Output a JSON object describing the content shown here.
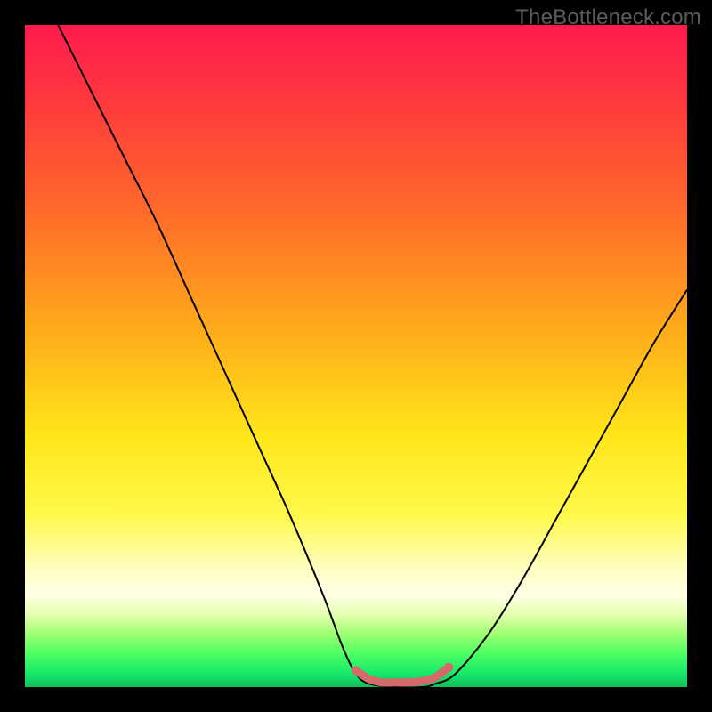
{
  "watermark": "TheBottleneck.com",
  "chart_data": {
    "type": "line",
    "title": "",
    "xlabel": "",
    "ylabel": "",
    "xlim": [
      0,
      100
    ],
    "ylim": [
      0,
      100
    ],
    "grid": false,
    "legend": false,
    "background": {
      "type": "vertical-gradient",
      "stops": [
        {
          "pct": 0,
          "color": "#ff1a4d"
        },
        {
          "pct": 12,
          "color": "#ff3a3d"
        },
        {
          "pct": 28,
          "color": "#ff6a2a"
        },
        {
          "pct": 48,
          "color": "#ffb21a"
        },
        {
          "pct": 62,
          "color": "#ffe61a"
        },
        {
          "pct": 74,
          "color": "#fff94a"
        },
        {
          "pct": 82,
          "color": "#fffec0"
        },
        {
          "pct": 86,
          "color": "#ffffe6"
        },
        {
          "pct": 89,
          "color": "#e6ffb0"
        },
        {
          "pct": 92,
          "color": "#9dff70"
        },
        {
          "pct": 95,
          "color": "#4cff63"
        },
        {
          "pct": 98,
          "color": "#16e86a"
        },
        {
          "pct": 100,
          "color": "#0fbf5b"
        }
      ]
    },
    "series": [
      {
        "name": "bottleneck-curve",
        "color": "#000000",
        "stroke_width": 2,
        "x": [
          5,
          10,
          15,
          20,
          25,
          30,
          35,
          40,
          45,
          48,
          50,
          52,
          56,
          60,
          62,
          65,
          70,
          75,
          80,
          85,
          90,
          95,
          100
        ],
        "y": [
          100,
          90,
          80,
          70,
          59,
          48,
          37,
          26,
          14,
          6,
          2,
          0.5,
          0,
          0,
          0.5,
          2,
          8,
          16,
          25,
          34,
          43,
          52,
          60
        ]
      },
      {
        "name": "optimal-range-highlight",
        "color": "#d46a6a",
        "stroke_width": 9,
        "x": [
          50,
          52,
          54,
          56,
          58,
          60,
          62,
          64
        ],
        "y": [
          2.5,
          1.2,
          0.7,
          0.7,
          0.7,
          0.9,
          1.5,
          3.0
        ]
      }
    ],
    "markers": [
      {
        "x": 50,
        "y": 2.5,
        "color": "#d46a6a",
        "r": 5
      },
      {
        "x": 64,
        "y": 3.0,
        "color": "#d46a6a",
        "r": 5
      }
    ]
  }
}
